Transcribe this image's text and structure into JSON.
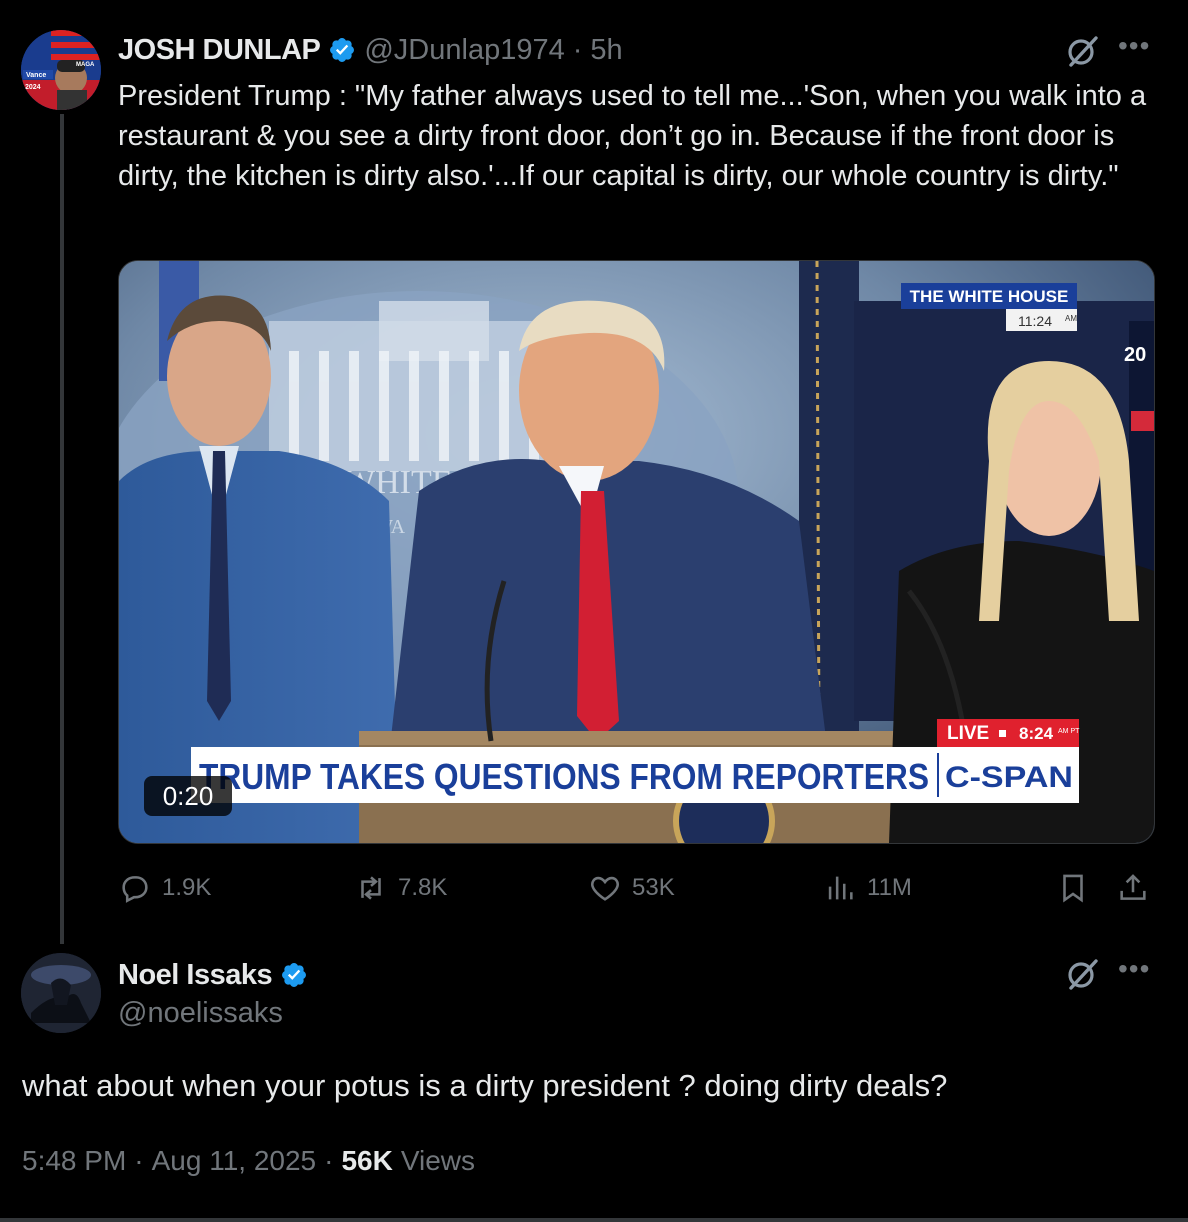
{
  "tweet": {
    "author_name": "JOSH DUNLAP",
    "author_handle": "@JDunlap1974",
    "separator": "·",
    "time": "5h",
    "text": "President Trump : \"My father always used to tell me...'Son, when you walk into a restaurant & you see a dirty front door, don’t go in. Because if the front door is dirty, the kitchen is dirty also.'...If our capital is dirty, our whole country is dirty.\"",
    "avatar_text": [
      "Vance",
      "MAGA",
      "2024"
    ],
    "video": {
      "duration": "0:20",
      "location_bug": "THE WHITE HOUSE",
      "location_time": "11:24",
      "location_ampm": "AM",
      "seal_text": "THE WHITE",
      "seal_sub": "WA",
      "lower_third": "TRUMP TAKES QUESTIONS FROM REPORTERS",
      "network": "C-SPAN",
      "live_label": "LIVE",
      "live_time": "8:24",
      "live_ampm": "AM PT",
      "edge_text": "20"
    },
    "stats": {
      "replies": "1.9K",
      "reposts": "7.8K",
      "likes": "53K",
      "views": "11M"
    }
  },
  "reply": {
    "author_name": "Noel Issaks",
    "author_handle": "@noelissaks",
    "text": "what about when your potus is a dirty president ? doing dirty deals?",
    "time": "5:48 PM",
    "date": "Aug 11, 2025",
    "views_count": "56K",
    "views_label": "Views",
    "separator": "·"
  },
  "icons": {
    "verified": "verified-badge-icon",
    "grok": "grok-icon",
    "more": "more-icon",
    "reply": "reply-icon",
    "repost": "repost-icon",
    "like": "like-icon",
    "views": "views-icon",
    "bookmark": "bookmark-icon",
    "share": "share-icon"
  },
  "colors": {
    "background": "#000000",
    "text": "#e7e9ea",
    "muted": "#71767b",
    "verified": "#1d9bf0",
    "cspan_blue": "#1a3f9a",
    "live_red": "#e0212e"
  }
}
